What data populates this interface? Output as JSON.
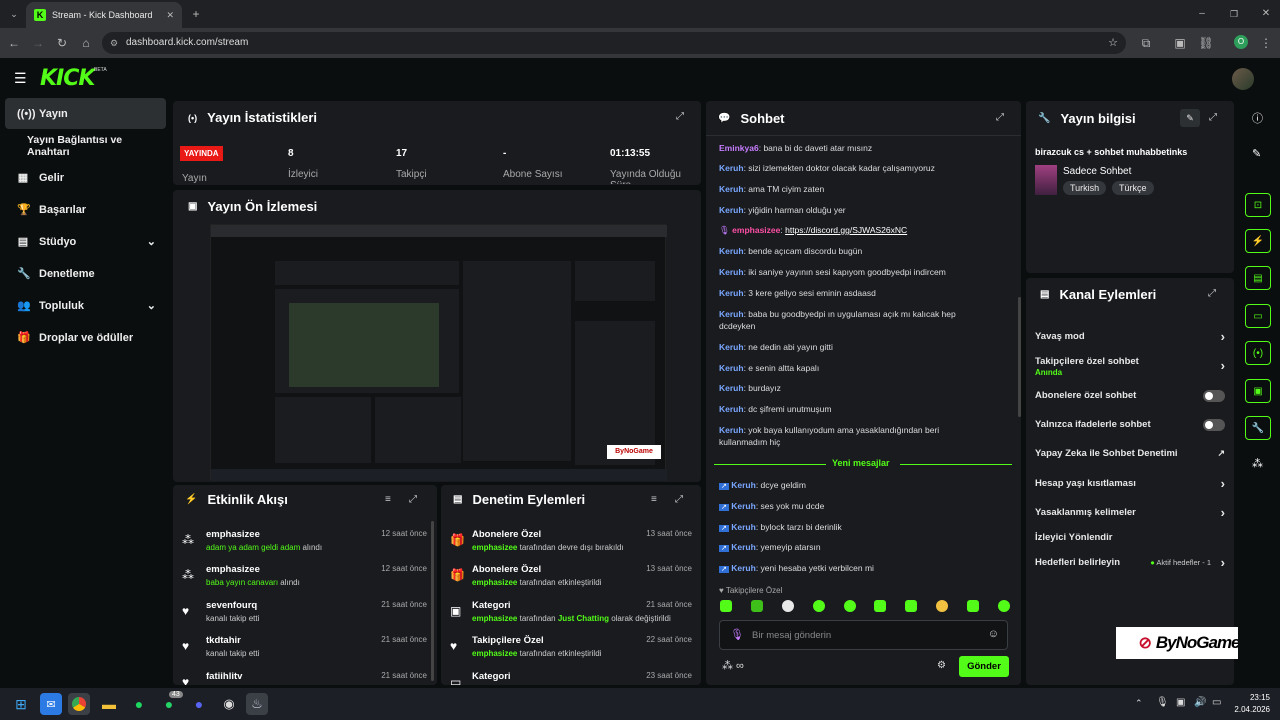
{
  "browser": {
    "tab_title": "Stream - Kick Dashboard",
    "url": "dashboard.kick.com/stream",
    "profile_initial": "O"
  },
  "brand": {
    "logo": "KICK",
    "beta": "BETA",
    "accent": "#53fc18"
  },
  "sidebar": {
    "items": [
      {
        "label": "Yayın",
        "icon": "broadcast-icon"
      },
      {
        "label": "Yayın Bağlantısı ve Anahtarı"
      },
      {
        "label": "Gelir",
        "icon": "chart-icon"
      },
      {
        "label": "Başarılar",
        "icon": "trophy-icon"
      },
      {
        "label": "Stüdyo",
        "icon": "studio-icon"
      },
      {
        "label": "Denetleme",
        "icon": "wrench-icon"
      },
      {
        "label": "Topluluk",
        "icon": "community-icon"
      },
      {
        "label": "Droplar ve ödüller",
        "icon": "gift-icon"
      }
    ]
  },
  "stats": {
    "title": "Yayın İstatistikleri",
    "live_badge": "YAYINDA",
    "live_label": "Yayın",
    "items": [
      {
        "value": "8",
        "label": "İzleyici"
      },
      {
        "value": "17",
        "label": "Takipçi"
      },
      {
        "value": "-",
        "label": "Abone Sayısı"
      },
      {
        "value": "01:13:55",
        "label": "Yayında Olduğu Süre"
      }
    ]
  },
  "preview": {
    "title": "Yayın Ön İzlemesi"
  },
  "activity": {
    "title": "Etkinlik Akışı",
    "items": [
      {
        "user": "emphasizee",
        "detail": "adam ya adam geldi adam",
        "suffix": "alındı",
        "time": "12 saat önce"
      },
      {
        "user": "emphasizee",
        "detail": "baba yayın canavarı",
        "suffix": "alındı",
        "time": "12 saat önce"
      },
      {
        "user": "sevenfourq",
        "detail": "kanalı takip etti",
        "suffix": "",
        "time": "21 saat önce"
      },
      {
        "user": "tkdtahir",
        "detail": "kanalı takip etti",
        "suffix": "",
        "time": "21 saat önce"
      },
      {
        "user": "fatiihlitv",
        "detail": "",
        "suffix": "",
        "time": "21 saat önce"
      }
    ]
  },
  "moderation": {
    "title": "Denetim Eylemleri",
    "items": [
      {
        "title": "Abonelere Özel",
        "actor": "emphasizee",
        "action": "tarafından devre dışı bırakıldı",
        "time": "13 saat önce"
      },
      {
        "title": "Abonelere Özel",
        "actor": "emphasizee",
        "action": "tarafından etkinleştirildi",
        "time": "13 saat önce"
      },
      {
        "title": "Kategori",
        "actor": "emphasizee",
        "action": "tarafından",
        "extra": "Just Chatting",
        "action2": "olarak değiştirildi",
        "time": "21 saat önce"
      },
      {
        "title": "Takipçilere Özel",
        "actor": "emphasizee",
        "action": "tarafından etkinleştirildi",
        "time": "22 saat önce"
      },
      {
        "title": "Kategori",
        "actor": "",
        "action": "",
        "time": "23 saat önce"
      }
    ]
  },
  "chat": {
    "title": "Sohbet",
    "messages": [
      {
        "user": "Eminkya6",
        "text": "bana bi dc daveti atar mısınz"
      },
      {
        "user": "Keruh",
        "text": "sizi izlemekten doktor olacak kadar çalışamıyoruz"
      },
      {
        "user": "Keruh",
        "text": "ama TM ciyim zaten"
      },
      {
        "user": "Keruh",
        "text": "yiğidin harman olduğu yer"
      },
      {
        "user": "emphasizee",
        "text": "https://discord.gg/SJWAS26xNC"
      },
      {
        "user": "Keruh",
        "text": "bende açıcam discordu bugün"
      },
      {
        "user": "Keruh",
        "text": "iki saniye yayının sesi kapıyom goodbyedpi indircem"
      },
      {
        "user": "Keruh",
        "text": "3 kere geliyo sesi eminin asdaasd"
      },
      {
        "user": "Keruh",
        "text": "baba bu goodbyedpi ın uygulaması açık mı kalıcak hep dcdeyken"
      },
      {
        "user": "Keruh",
        "text": "ne dedin abi yayın gitti"
      },
      {
        "user": "Keruh",
        "text": "e senin altta kapalı"
      },
      {
        "user": "Keruh",
        "text": "burdayız"
      },
      {
        "user": "Keruh",
        "text": "dc şifremi unutmuşum"
      },
      {
        "user": "Keruh",
        "text": "yok baya kullanıyodum ama yasaklandığından beri kullanmadım hiç"
      }
    ],
    "new_label": "Yeni mesajlar",
    "new_messages": [
      {
        "user": "Keruh",
        "text": "dcye geldim"
      },
      {
        "user": "Keruh",
        "text": "ses yok mu dcde"
      },
      {
        "user": "Keruh",
        "text": "bylock tarzı bi derinlik"
      },
      {
        "user": "Keruh",
        "text": "yemeyip atarsın"
      },
      {
        "user": "Keruh",
        "text": "yeni hesaba yetki verbilcen mi"
      }
    ],
    "followers_only": "Takipçilere Özel",
    "input_placeholder": "Bir mesaj gönderin",
    "send": "Gönder"
  },
  "info": {
    "title": "Yayın bilgisi",
    "stream_title": "birazcuk cs + sohbet muhabbetinks",
    "category": "Sadece Sohbet",
    "tags": [
      "Turkish",
      "Türkçe"
    ]
  },
  "channel": {
    "title": "Kanal Eylemleri",
    "items": [
      {
        "label": "Yavaş mod",
        "kind": "arrow"
      },
      {
        "label": "Takipçilere özel sohbet",
        "sub": "Anında",
        "kind": "arrow"
      },
      {
        "label": "Abonelere özel sohbet",
        "kind": "toggle"
      },
      {
        "label": "Yalnızca ifadelerle sohbet",
        "kind": "toggle"
      },
      {
        "label": "Yapay Zeka ile Sohbet Denetimi",
        "kind": "link"
      },
      {
        "label": "Hesap yaşı kısıtlaması",
        "kind": "arrow"
      },
      {
        "label": "Yasaklanmış kelimeler",
        "kind": "arrow"
      },
      {
        "label": "İzleyici Yönlendir",
        "kind": "none"
      },
      {
        "label": "Hedefleri belirleyin",
        "extra": "Aktif hedefler - 1",
        "kind": "arrow"
      }
    ]
  },
  "watermark": "ByNoGame",
  "taskbar": {
    "time": "23:15",
    "date": "2.04.2026",
    "badge": "43"
  }
}
